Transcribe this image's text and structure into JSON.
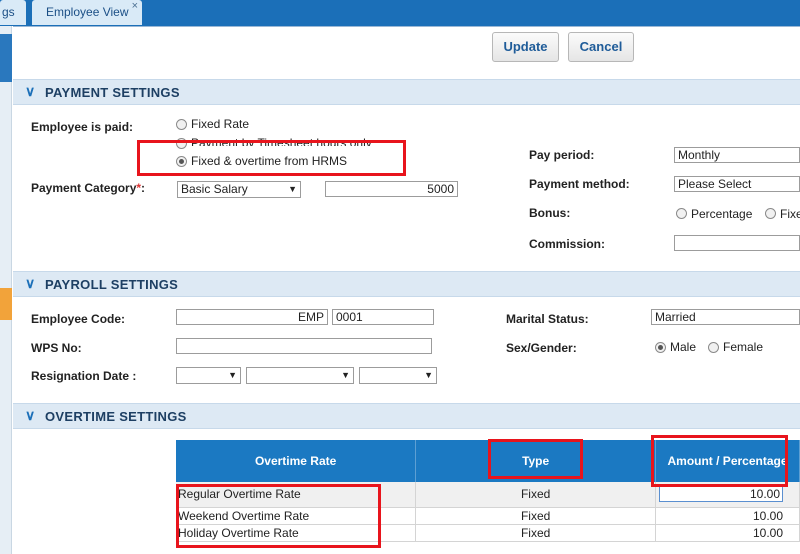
{
  "tabs": {
    "left_label": "gs",
    "active_label": "Employee View",
    "close_glyph": "×"
  },
  "toolbar": {
    "update_label": "Update",
    "cancel_label": "Cancel"
  },
  "payment": {
    "section_title": "PAYMENT SETTINGS",
    "employee_paid_label": "Employee is paid:",
    "paid_options": [
      "Fixed Rate",
      "Payment by Timesheet hours only",
      "Fixed & overtime from HRMS"
    ],
    "paid_selected": "Fixed & overtime from HRMS",
    "category_label": "Payment Category",
    "category_required": "*",
    "category_colon": ":",
    "category_value": "Basic Salary",
    "amount_value": "5000",
    "pay_period_label": "Pay period:",
    "pay_period_value": "Monthly",
    "method_label": "Payment method:",
    "method_value": "Please Select",
    "bonus_label": "Bonus:",
    "bonus_options": [
      "Percentage",
      "Fixe"
    ],
    "commission_label": "Commission:",
    "commission_value": ""
  },
  "payroll": {
    "section_title": "PAYROLL SETTINGS",
    "code_label": "Employee Code:",
    "code_prefix": "EMP",
    "code_number": "0001",
    "wps_label": "WPS No:",
    "wps_value": "",
    "resignation_label": "Resignation Date :",
    "marital_label": "Marital Status:",
    "marital_value": "Married",
    "gender_label": "Sex/Gender:",
    "gender_options": [
      "Male",
      "Female"
    ],
    "gender_selected": "Male"
  },
  "overtime": {
    "section_title": "OVERTIME SETTINGS",
    "columns": [
      "Overtime Rate",
      "Type",
      "Amount / Percentage"
    ],
    "rows": [
      {
        "rate": "Regular Overtime Rate",
        "type": "Fixed",
        "amount": "10.00"
      },
      {
        "rate": "Weekend Overtime Rate",
        "type": "Fixed",
        "amount": "10.00"
      },
      {
        "rate": "Holiday Overtime Rate",
        "type": "Fixed",
        "amount": "10.00"
      }
    ]
  },
  "colors": {
    "accent": "#1b6fb8",
    "header": "#1b79c2",
    "highlight": "#e8141c"
  }
}
